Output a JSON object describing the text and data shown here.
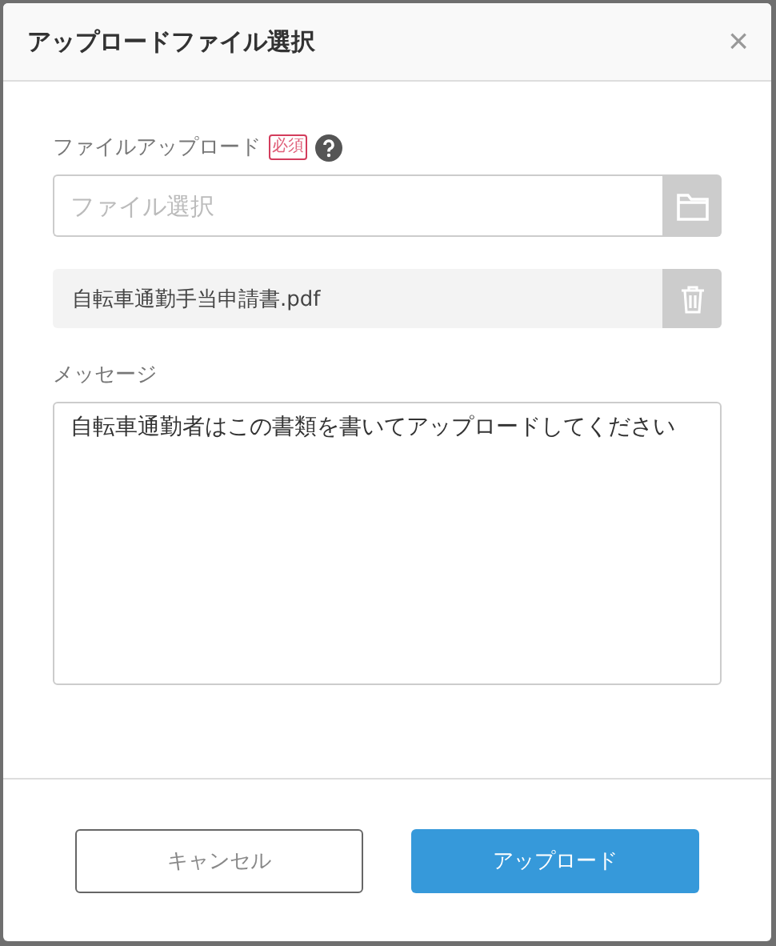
{
  "dialog": {
    "title": "アップロードファイル選択",
    "close": "×"
  },
  "upload": {
    "label": "ファイルアップロード",
    "required": "必須",
    "placeholder": "ファイル選択"
  },
  "files": [
    {
      "name": "自転車通勤手当申請書.pdf"
    }
  ],
  "message": {
    "label": "メッセージ",
    "value": "自転車通勤者はこの書類を書いてアップロードしてください"
  },
  "buttons": [
    {
      "label": "キャンセル",
      "kind": "secondary"
    },
    {
      "label": "アップロード",
      "kind": "primary"
    }
  ]
}
